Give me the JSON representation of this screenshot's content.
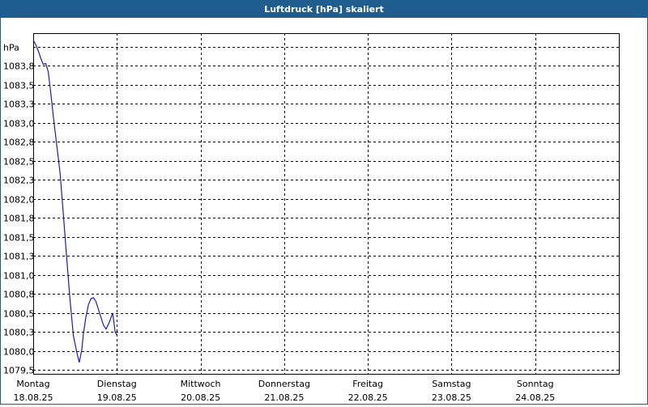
{
  "window": {
    "title": "Luftdruck [hPa] skaliert"
  },
  "colors": {
    "titlebar": "#1e5d8e",
    "series": "#1a1acc",
    "grid": "#000000"
  },
  "chart_data": {
    "type": "line",
    "title": "Luftdruck [hPa] skaliert",
    "ylabel": "hPa",
    "ylim": [
      79.45,
      83.93
    ],
    "yticks": [
      79.5,
      79.75,
      80.0,
      80.25,
      80.5,
      80.75,
      81.0,
      81.25,
      81.5,
      81.75,
      82.0,
      82.25,
      82.5,
      82.75,
      83.0,
      83.25,
      83.5,
      83.75
    ],
    "ytick_labels": [
      "1079,5",
      "1080,0",
      "1080,3",
      "1080,5",
      "1080,8",
      "1081,0",
      "1081,3",
      "1081,5",
      "1081,8",
      "1082,0",
      "1082,3",
      "1082,5",
      "1082,8",
      "1083,0",
      "1083,3",
      "1083,5",
      "1083,8",
      "hPa"
    ],
    "y_offset": 1000,
    "xlim": [
      0,
      7
    ],
    "x_categories": [
      {
        "day": "Montag",
        "date": "18.08.25"
      },
      {
        "day": "Dienstag",
        "date": "19.08.25"
      },
      {
        "day": "Mittwoch",
        "date": "20.08.25"
      },
      {
        "day": "Donnerstag",
        "date": "21.08.25"
      },
      {
        "day": "Freitag",
        "date": "22.08.25"
      },
      {
        "day": "Samstag",
        "date": "23.08.25"
      },
      {
        "day": "Sonntag",
        "date": "24.08.25"
      }
    ],
    "grid": true,
    "series": [
      {
        "x": [
          0.0,
          0.03,
          0.06,
          0.09,
          0.12,
          0.15,
          0.18,
          0.21,
          0.24,
          0.28,
          0.32,
          0.36,
          0.4,
          0.44,
          0.48,
          0.52,
          0.55,
          0.58,
          0.6,
          0.63,
          0.66,
          0.69,
          0.72,
          0.75,
          0.79,
          0.84,
          0.87,
          0.91,
          0.95,
          0.98,
          1.0
        ],
        "y": [
          83.84,
          83.78,
          83.7,
          83.6,
          83.52,
          83.53,
          83.42,
          83.14,
          82.84,
          82.47,
          82.1,
          81.55,
          80.98,
          80.43,
          79.95,
          79.74,
          79.6,
          79.76,
          79.98,
          80.2,
          80.36,
          80.44,
          80.45,
          80.4,
          80.26,
          80.09,
          80.04,
          80.13,
          80.25,
          80.0,
          79.96
        ]
      }
    ]
  }
}
